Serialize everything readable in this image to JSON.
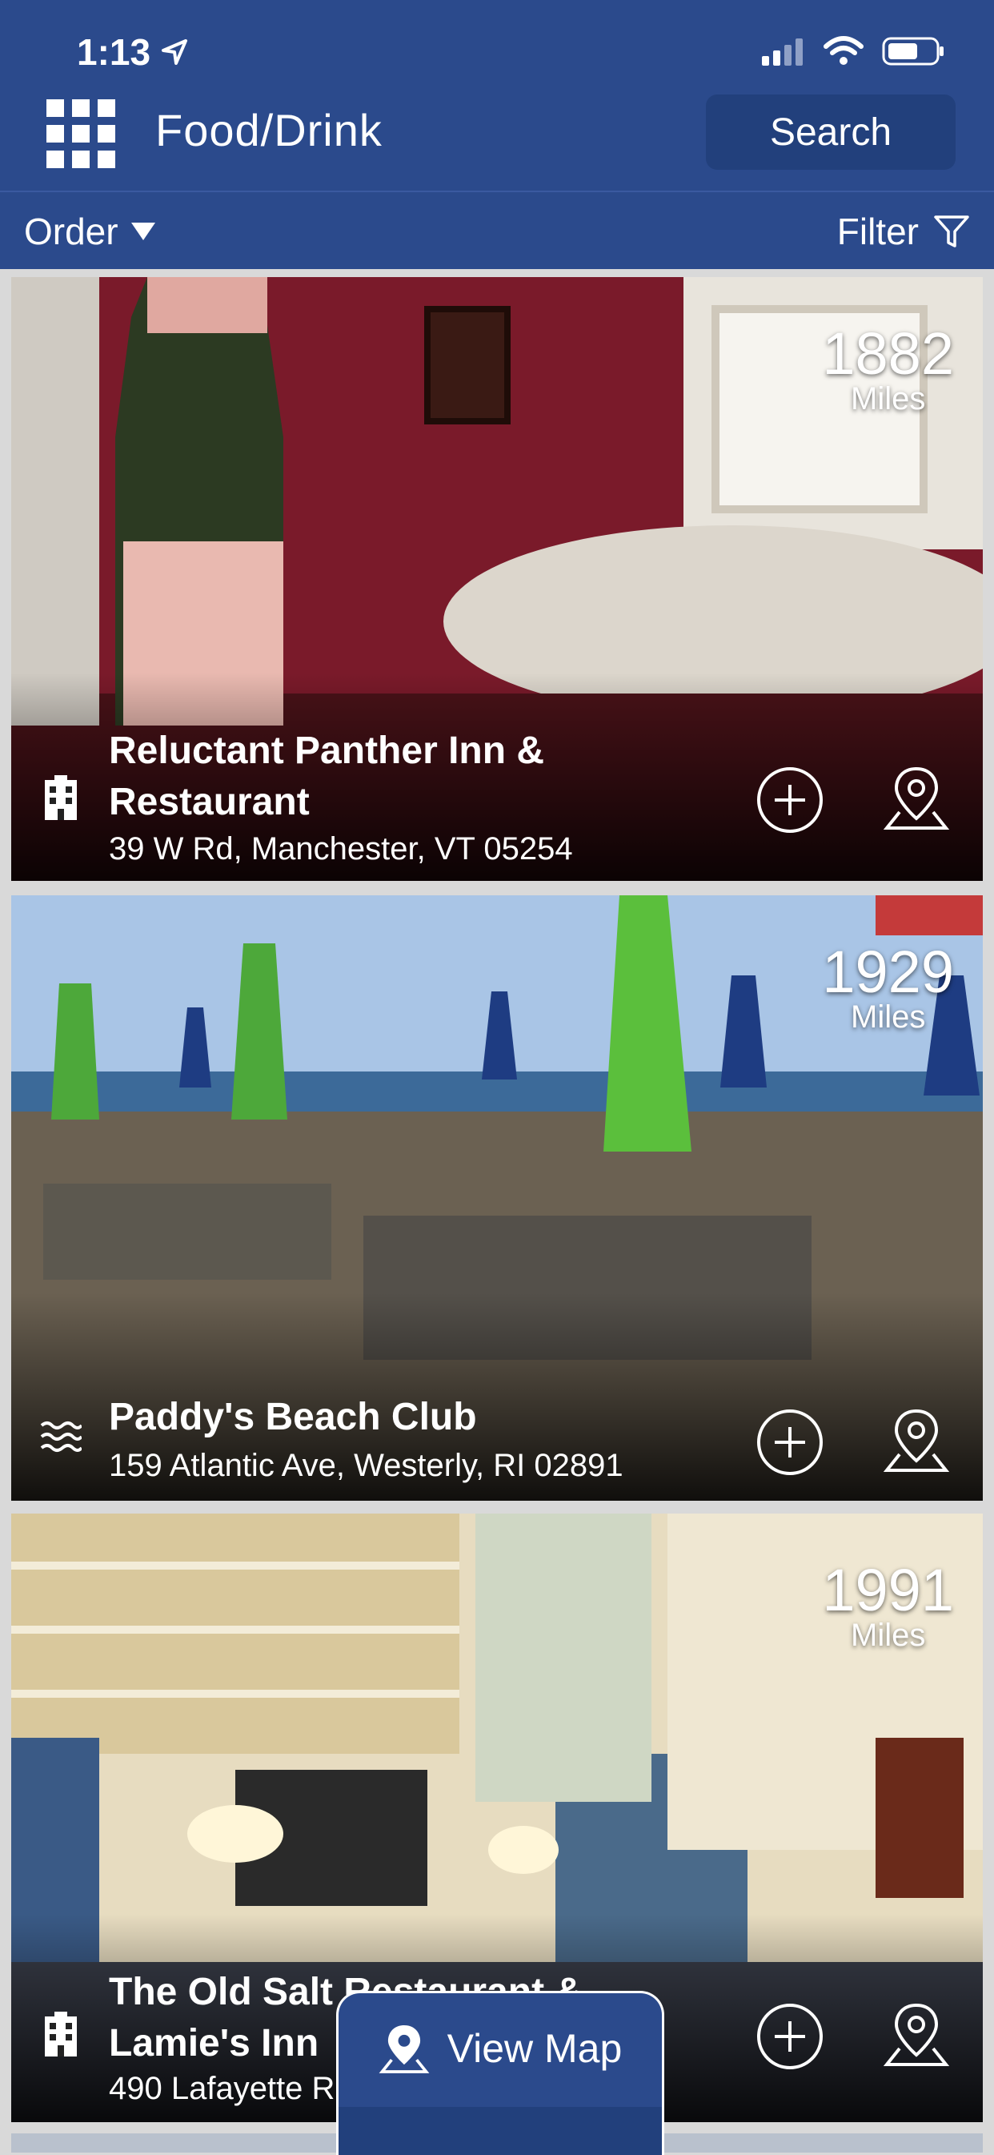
{
  "status": {
    "time": "1:13"
  },
  "header": {
    "title": "Food/Drink",
    "search_label": "Search"
  },
  "subbar": {
    "order_label": "Order",
    "filter_label": "Filter"
  },
  "colors": {
    "brand": "#2b4a8c",
    "brand_dark": "#22407c"
  },
  "listings": [
    {
      "name": "Reluctant Panther Inn & Restaurant",
      "address": "39 W Rd, Manchester, VT 05254",
      "distance": "1882",
      "distance_unit": "Miles",
      "category_icon": "hotel-icon"
    },
    {
      "name": "Paddy's Beach Club",
      "address": "159 Atlantic Ave, Westerly, RI 02891",
      "distance": "1929",
      "distance_unit": "Miles",
      "category_icon": "water-icon"
    },
    {
      "name": "The Old Salt Restaurant & Lamie's Inn",
      "address": "490 Lafayette R…",
      "distance": "1991",
      "distance_unit": "Miles",
      "category_icon": "hotel-icon"
    }
  ],
  "view_map": {
    "label": "View Map"
  }
}
